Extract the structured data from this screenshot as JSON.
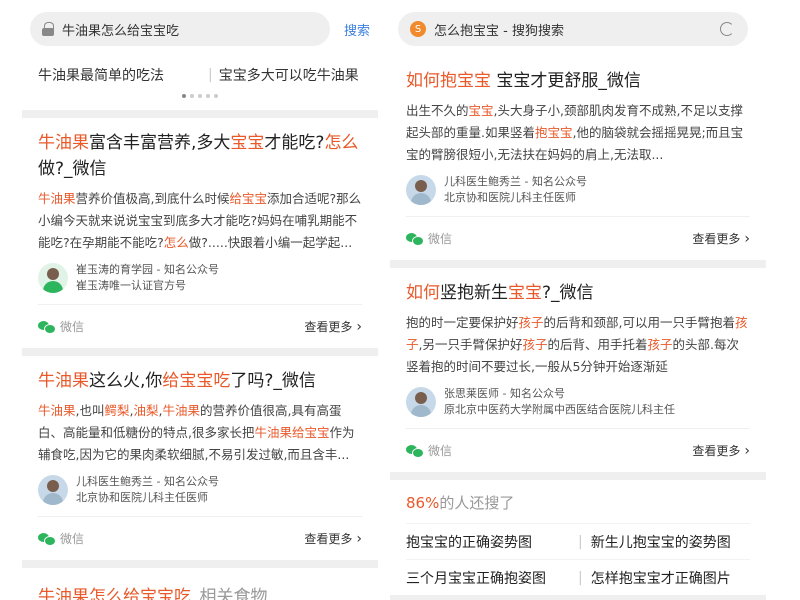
{
  "left": {
    "search_query": "牛油果怎么给宝宝吃",
    "search_button": "搜索",
    "related": [
      "牛油果最简单的吃法",
      "宝宝多大可以吃牛油果"
    ],
    "results": [
      {
        "title": [
          [
            "牛油果",
            "h"
          ],
          [
            "富含丰富营养,多大",
            ""
          ],
          [
            "宝宝",
            "h"
          ],
          [
            "才能吃?",
            ""
          ],
          [
            "怎么",
            "h"
          ],
          [
            "做?_微信",
            ""
          ]
        ],
        "snippet": [
          [
            "牛油果",
            "h"
          ],
          [
            "营养价值极高,到底什么时候",
            ""
          ],
          [
            "给宝宝",
            "h"
          ],
          [
            "添加合适呢?那么小编今天就来说说宝宝到底多大才能吃?妈妈在哺乳期能不能吃?在孕期能不能吃?",
            ""
          ],
          [
            "怎么",
            "h"
          ],
          [
            "做?.....快跟着小编一起学起...",
            ""
          ]
        ],
        "author_name": "崔玉涛的育学园 - 知名公众号",
        "author_desc": "崔玉涛唯一认证官方号",
        "source": "微信",
        "more": "查看更多"
      },
      {
        "title": [
          [
            "牛油果",
            "h"
          ],
          [
            "这么火,你",
            ""
          ],
          [
            "给宝宝吃",
            "h"
          ],
          [
            "了吗?_微信",
            ""
          ]
        ],
        "snippet": [
          [
            "牛油果",
            "h"
          ],
          [
            ",也叫",
            ""
          ],
          [
            "鳄梨",
            "h"
          ],
          [
            ",",
            ""
          ],
          [
            "油梨",
            "h"
          ],
          [
            ",",
            ""
          ],
          [
            "牛油果",
            "h"
          ],
          [
            "的营养价值很高,具有高蛋白、高能量和低糖份的特点,很多家长把",
            ""
          ],
          [
            "牛油果给宝宝",
            "h"
          ],
          [
            "作为辅食吃,因为它的果肉柔软细腻,不易引发过敏,而且含丰...",
            ""
          ]
        ],
        "author_name": "儿科医生鲍秀兰 - 知名公众号",
        "author_desc": "北京协和医院儿科主任医师",
        "source": "微信",
        "more": "查看更多"
      }
    ],
    "bottom_title_hl": "牛油果怎么给宝宝吃",
    "bottom_title_rest": "_相关食物"
  },
  "right": {
    "tab_title": "怎么抱宝宝 - 搜狗搜索",
    "logo_glyph": "S",
    "results": [
      {
        "title": [
          [
            "如何",
            "h"
          ],
          [
            "抱宝宝",
            "h"
          ],
          [
            " 宝宝才更舒服_微信",
            ""
          ]
        ],
        "snippet": [
          [
            "出生不久的",
            ""
          ],
          [
            "宝宝",
            "h"
          ],
          [
            ",头大身子小,颈部肌肉发育不成熟,不足以支撑起头部的重量.如果竖着",
            ""
          ],
          [
            "抱宝宝",
            "h"
          ],
          [
            ",他的脑袋就会摇摇晃晃;而且宝宝的臂膀很短小,无法扶在妈妈的肩上,无法取...",
            ""
          ]
        ],
        "author_name": "儿科医生鲍秀兰 - 知名公众号",
        "author_desc": "北京协和医院儿科主任医师",
        "source": "微信",
        "more": "查看更多"
      },
      {
        "title": [
          [
            "如何",
            "h"
          ],
          [
            "竖抱新生",
            ""
          ],
          [
            "宝宝",
            "h"
          ],
          [
            "?_微信",
            ""
          ]
        ],
        "snippet": [
          [
            "抱的时一定要保护好",
            ""
          ],
          [
            "孩子",
            "h"
          ],
          [
            "的后背和颈部,可以用一只手臂抱着",
            ""
          ],
          [
            "孩子",
            "h"
          ],
          [
            ",另一只手臂保护好",
            ""
          ],
          [
            "孩子",
            "h"
          ],
          [
            "的后背、用手托着",
            ""
          ],
          [
            "孩子",
            "h"
          ],
          [
            "的头部.每次竖着抱的时间不要过长,一般从5分钟开始逐渐延",
            ""
          ]
        ],
        "author_name": "张思莱医师 - 知名公众号",
        "author_desc": "原北京中医药大学附属中西医结合医院儿科主任",
        "source": "微信",
        "more": "查看更多"
      }
    ],
    "also_pct": "86%",
    "also_label": "的人还搜了",
    "also_searched": [
      [
        "抱宝宝的正确姿势图",
        "新生儿抱宝宝的姿势图"
      ],
      [
        "三个月宝宝正确抱姿图",
        "怎样抱宝宝才正确图片"
      ]
    ]
  }
}
